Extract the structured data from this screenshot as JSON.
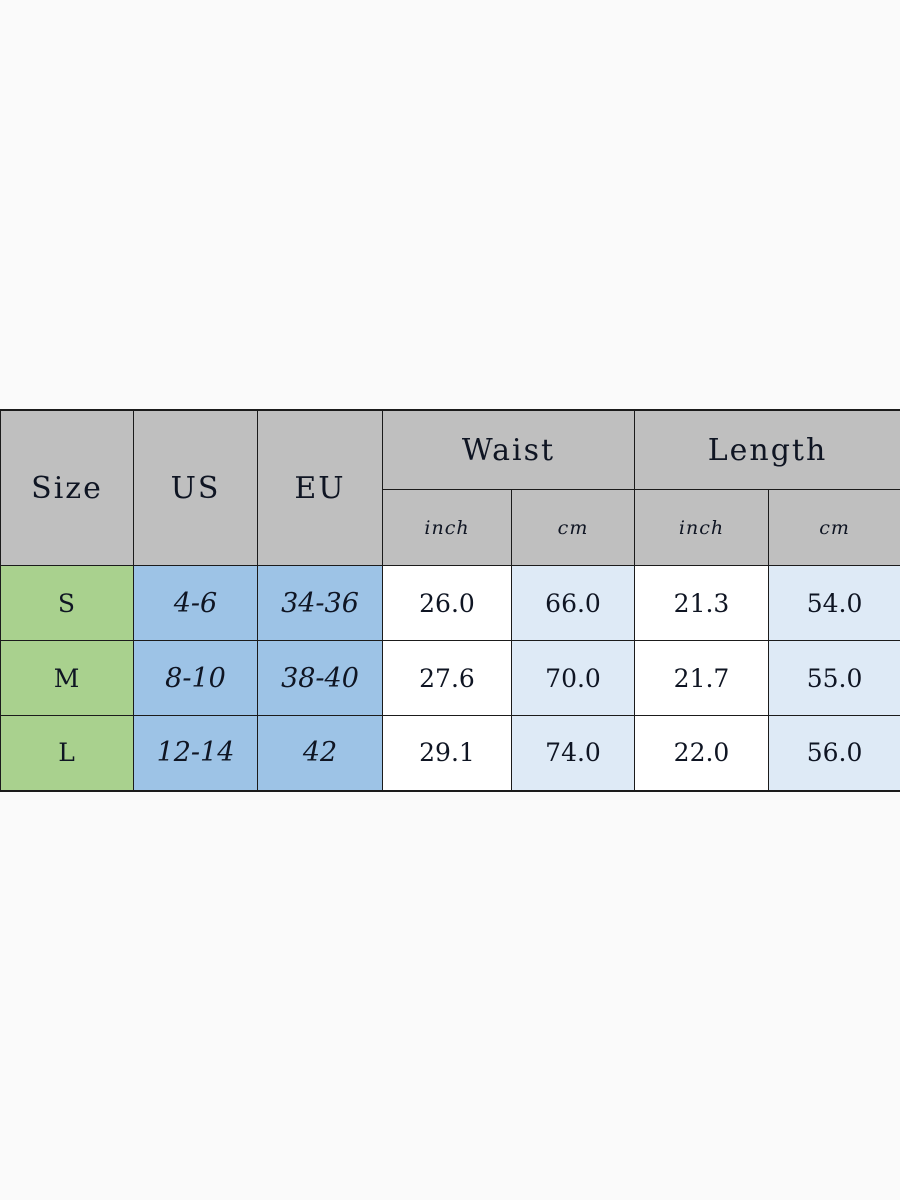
{
  "table": {
    "columns": {
      "size": "Size",
      "us": "US",
      "eu": "EU",
      "waist": "Waist",
      "length": "Length",
      "waist_inch": "inch",
      "waist_cm": "cm",
      "length_inch": "inch",
      "length_cm": "cm"
    },
    "colors": {
      "header_bg": "#bfbfbf",
      "size_bg": "#a9d18e",
      "region_bg": "#9dc3e6",
      "inch_bg": "#ffffff",
      "cm_bg": "#deeaf6",
      "border": "#1b1b1b",
      "page_bg": "#fafafa",
      "text": "#0f1523"
    },
    "rows": [
      {
        "size": "S",
        "us": "4-6",
        "eu": "34-36",
        "waist_inch": "26.0",
        "waist_cm": "66.0",
        "length_inch": "21.3",
        "length_cm": "54.0"
      },
      {
        "size": "M",
        "us": "8-10",
        "eu": "38-40",
        "waist_inch": "27.6",
        "waist_cm": "70.0",
        "length_inch": "21.7",
        "length_cm": "55.0"
      },
      {
        "size": "L",
        "us": "12-14",
        "eu": "42",
        "waist_inch": "29.1",
        "waist_cm": "74.0",
        "length_inch": "22.0",
        "length_cm": "56.0"
      }
    ]
  }
}
